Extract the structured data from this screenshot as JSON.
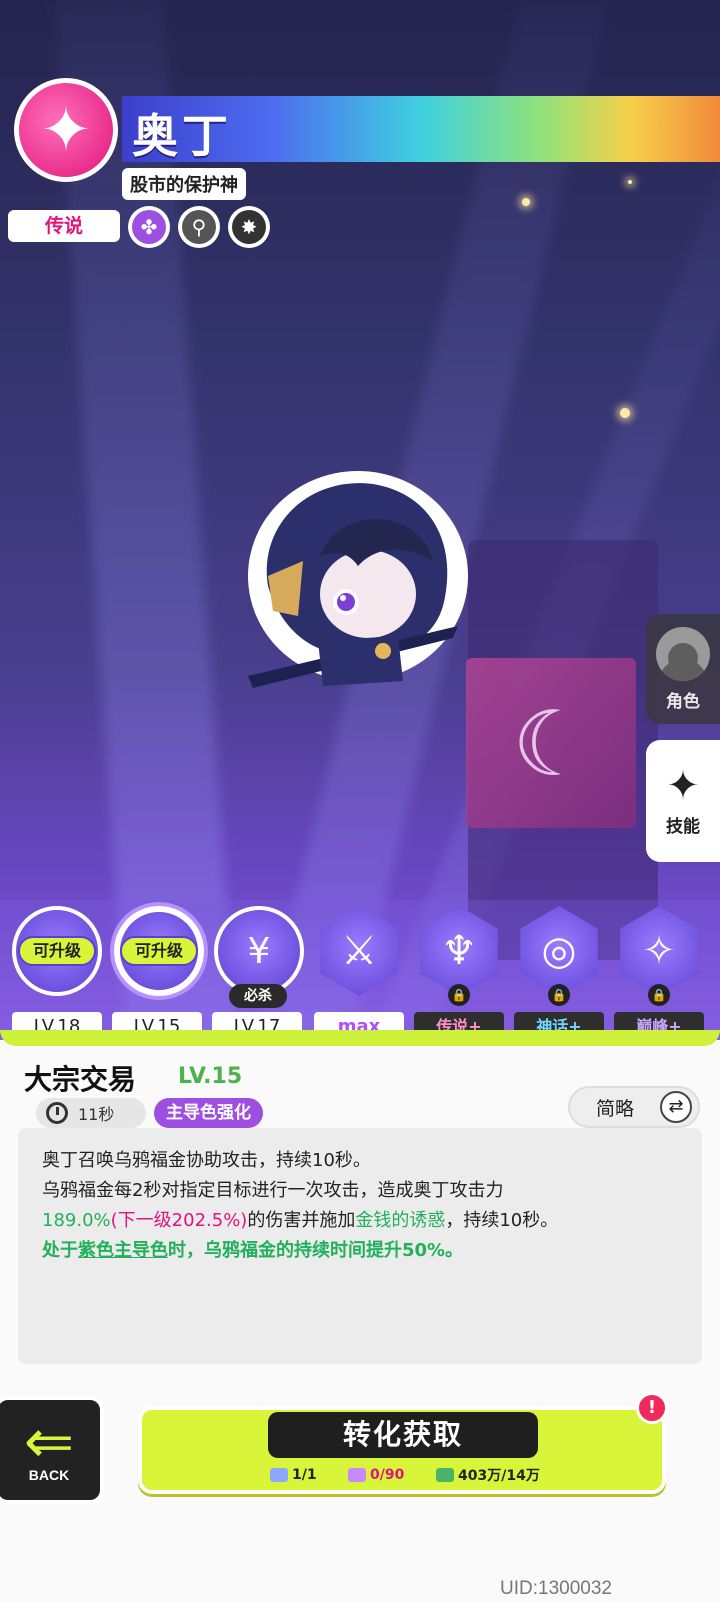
{
  "header": {
    "name": "奥丁",
    "subtitle": "股市的保护神",
    "rarity": "传说",
    "colors": {
      "rarity": "#e0157c",
      "emblem": "#ff3d9a"
    },
    "traits": [
      {
        "icon": "clover-icon",
        "glyph": "✤",
        "color": "#9c4fe0"
      },
      {
        "icon": "magnifier-icon",
        "glyph": "⚲",
        "color": "#444444"
      },
      {
        "icon": "burst-icon",
        "glyph": "✸",
        "color": "#333333"
      }
    ]
  },
  "side_tabs": [
    {
      "label": "角色"
    },
    {
      "label": "技能"
    }
  ],
  "skills": [
    {
      "upgrade": "可升级",
      "level": "LV.18"
    },
    {
      "upgrade": "可升级",
      "level": "LV.15",
      "selected": true
    },
    {
      "badge": "必杀",
      "level": "LV.17"
    },
    {
      "level": "max"
    },
    {
      "level": "传说+",
      "level_color": "#ff8fd0",
      "locked": true
    },
    {
      "level": "神话+",
      "level_color": "#6fd8ff",
      "locked": true
    },
    {
      "level": "巅峰+",
      "level_color": "#c9a6ff",
      "locked": true
    }
  ],
  "detail": {
    "name": "大宗交易",
    "level": "LV.15",
    "cooldown": "11秒",
    "tag": "主导色强化",
    "brief_label": "简略",
    "desc": {
      "l1": "奥丁召唤乌鸦福金协助攻击，持续10秒。",
      "l2": "乌鸦福金每2秒对指定目标进行一次攻击，造成奥丁攻击力",
      "l3_a": "189.0%",
      "l3_b": "(下一级202.5%)",
      "l3_c": "的伤害并施加",
      "l3_d": "金钱的诱惑",
      "l3_e": "，持续10秒。",
      "l4_a": "处于",
      "l4_b": "紫色主导色",
      "l4_c": "时，乌鸦福金的持续时间提升50%。"
    }
  },
  "bottom": {
    "back_label": "BACK",
    "convert_label": "转化获取",
    "costs": [
      {
        "icon": "card-icon",
        "value": "1/1",
        "color": "#222222"
      },
      {
        "icon": "shard-icon",
        "value": "0/90",
        "color": "#e0147c"
      },
      {
        "icon": "money-icon",
        "value": "403万/14万",
        "color": "#222222"
      }
    ],
    "alert": "!",
    "uid": "UID:1300032"
  }
}
